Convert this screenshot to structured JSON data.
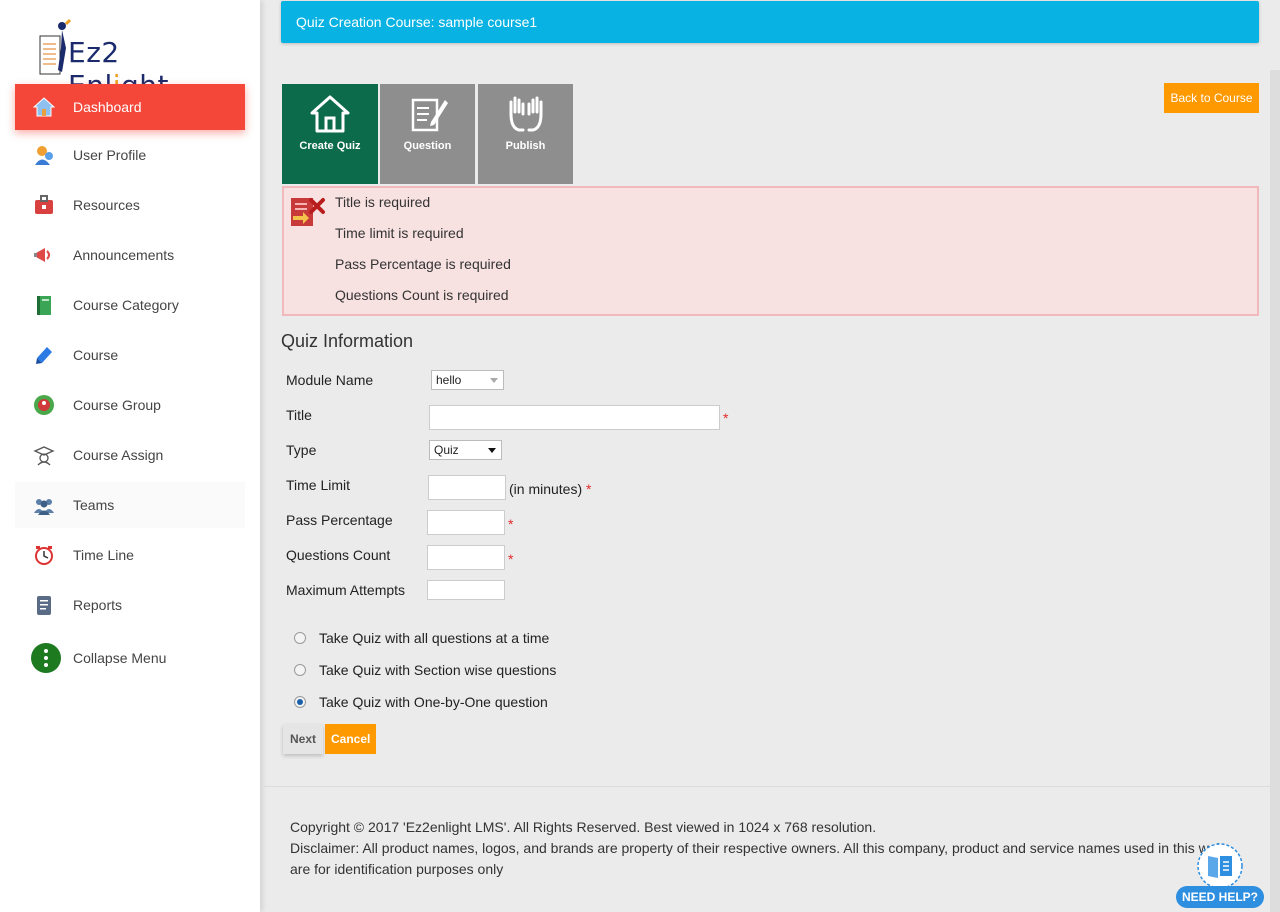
{
  "brand": {
    "logo_text_a": "Ez2 Enl",
    "logo_text_b": "i",
    "logo_text_c": "ght"
  },
  "sidebar": {
    "items": [
      {
        "label": "Dashboard",
        "icon": "home-icon"
      },
      {
        "label": "User Profile",
        "icon": "user-icon"
      },
      {
        "label": "Resources",
        "icon": "briefcase-icon"
      },
      {
        "label": "Announcements",
        "icon": "megaphone-icon"
      },
      {
        "label": "Course Category",
        "icon": "book-icon"
      },
      {
        "label": "Course",
        "icon": "pencil-book-icon"
      },
      {
        "label": "Course Group",
        "icon": "group-badge-icon"
      },
      {
        "label": "Course Assign",
        "icon": "graduate-icon"
      },
      {
        "label": "Teams",
        "icon": "team-icon"
      },
      {
        "label": "Time Line",
        "icon": "clock-icon"
      },
      {
        "label": "Reports",
        "icon": "report-icon"
      },
      {
        "label": "Collapse Menu",
        "icon": "more-vertical-icon"
      }
    ]
  },
  "header": {
    "title": "Quiz Creation Course: sample course1"
  },
  "steps": [
    {
      "label": "Create Quiz",
      "icon": "home-icon"
    },
    {
      "label": "Question",
      "icon": "edit-document-icon"
    },
    {
      "label": "Publish",
      "icon": "raised-hands-icon"
    }
  ],
  "back_button": "Back to Course",
  "errors": [
    "Title is required",
    "Time limit is required",
    "Pass Percentage is required",
    "Questions Count is required"
  ],
  "form": {
    "section_title": "Quiz Information",
    "module_name": {
      "label": "Module Name",
      "value": "hello"
    },
    "title": {
      "label": "Title",
      "value": "",
      "required": "*"
    },
    "type": {
      "label": "Type",
      "value": "Quiz"
    },
    "time_limit": {
      "label": "Time Limit",
      "suffix": "(in minutes)",
      "value": "",
      "required": "*"
    },
    "pass_percentage": {
      "label": "Pass Percentage",
      "value": "",
      "required": "*"
    },
    "questions_count": {
      "label": "Questions Count",
      "value": "",
      "required": "*"
    },
    "max_attempts": {
      "label": "Maximum Attempts",
      "value": ""
    },
    "modes": [
      {
        "label": "Take Quiz with all questions at a time",
        "checked": false
      },
      {
        "label": "Take Quiz with Section wise questions",
        "checked": false
      },
      {
        "label": "Take Quiz with One-by-One question",
        "checked": true
      }
    ],
    "next_label": "Next",
    "cancel_label": "Cancel"
  },
  "footer": {
    "copyright": "Copyright © 2017 'Ez2enlight LMS'. All Rights Reserved. Best viewed in 1024 x 768 resolution.",
    "disclaimer_1": "Disclaimer: All product names, logos, and brands are property of their respective owners. All this company, product and service names used in this web",
    "disclaimer_2": "are for identification purposes only"
  },
  "help": {
    "label": "NEED HELP?"
  },
  "colors": {
    "active_nav": "#f4473a",
    "header": "#08b2e2",
    "active_step": "#0c6b4a",
    "inactive_step": "#8e8e8e",
    "orange": "#ff9900",
    "error_bg": "#f8e1e1"
  }
}
